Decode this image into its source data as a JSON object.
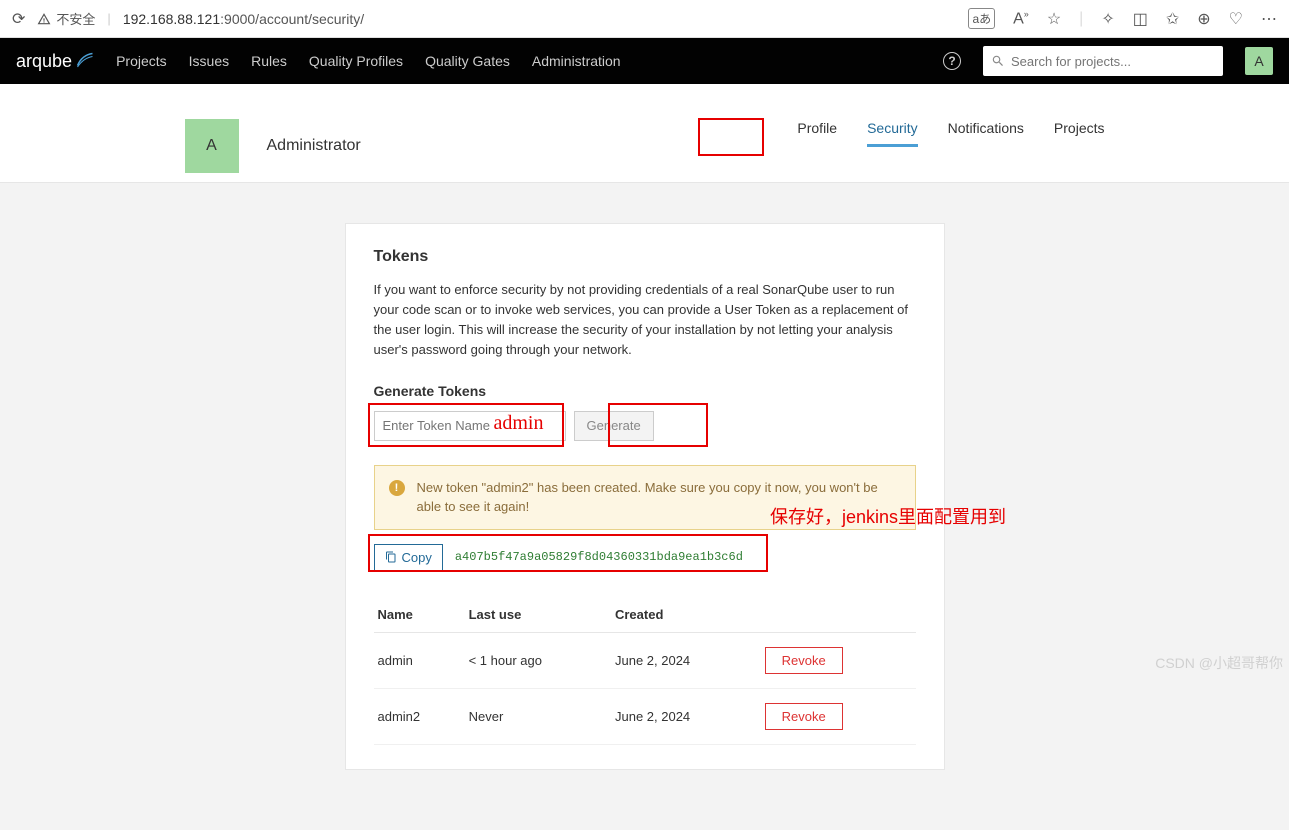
{
  "browser": {
    "insecure_label": "不安全",
    "url_host": "192.168.88.121",
    "url_port_path": ":9000/account/security/",
    "translate_badge": "aあ"
  },
  "topnav": {
    "logo": "arqube",
    "items": [
      "Projects",
      "Issues",
      "Rules",
      "Quality Profiles",
      "Quality Gates",
      "Administration"
    ],
    "search_placeholder": "Search for projects...",
    "avatar_letter": "A"
  },
  "subheader": {
    "avatar_letter": "A",
    "username": "Administrator",
    "tabs": [
      "Profile",
      "Security",
      "Notifications",
      "Projects"
    ],
    "active_tab": "Security"
  },
  "tokens": {
    "title": "Tokens",
    "description": "If you want to enforce security by not providing credentials of a real SonarQube user to run your code scan or to invoke web services, you can provide a User Token as a replacement of the user login. This will increase the security of your installation by not letting your analysis user's password going through your network.",
    "generate_title": "Generate Tokens",
    "input_placeholder": "Enter Token Name",
    "generate_button": "Generate",
    "alert": "New token \"admin2\" has been created. Make sure you copy it now, you won't be able to see it again!",
    "copy_button": "Copy",
    "token_value": "a407b5f47a9a05829f8d04360331bda9ea1b3c6d",
    "table": {
      "headers": [
        "Name",
        "Last use",
        "Created",
        ""
      ],
      "rows": [
        {
          "name": "admin",
          "last_use": "< 1 hour ago",
          "created": "June 2, 2024",
          "action": "Revoke"
        },
        {
          "name": "admin2",
          "last_use": "Never",
          "created": "June 2, 2024",
          "action": "Revoke"
        }
      ]
    }
  },
  "annotations": {
    "admin_text": "admin",
    "save_text": "保存好，jenkins里面配置用到"
  },
  "watermark": "CSDN @小超哥帮你"
}
